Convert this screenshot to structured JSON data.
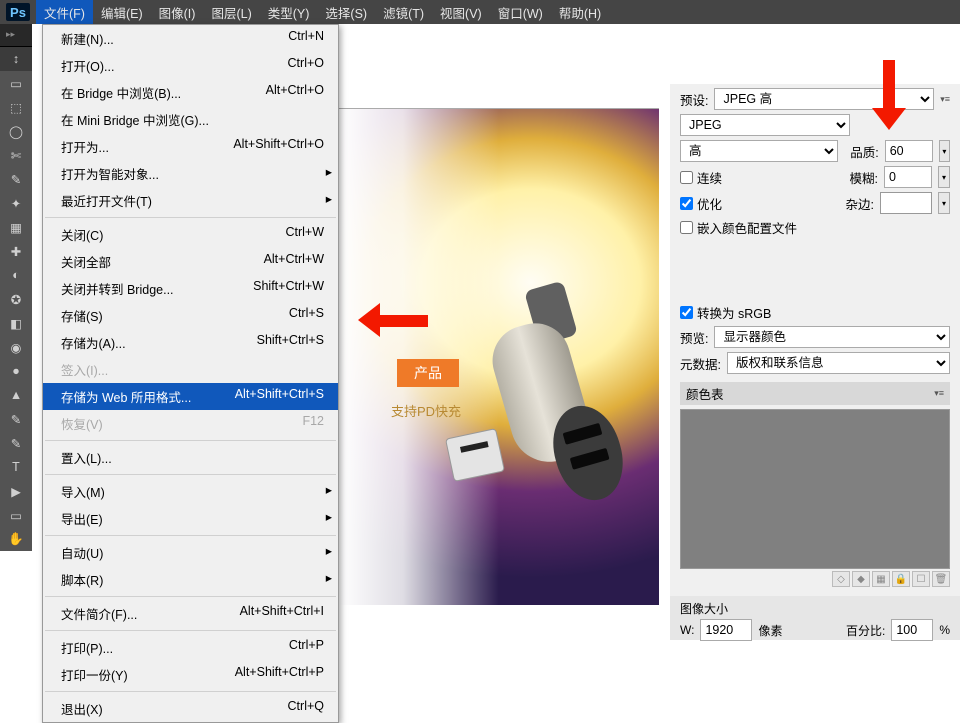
{
  "menubar": {
    "items": [
      "文件(F)",
      "编辑(E)",
      "图像(I)",
      "图层(L)",
      "类型(Y)",
      "选择(S)",
      "滤镜(T)",
      "视图(V)",
      "窗口(W)",
      "帮助(H)"
    ]
  },
  "file_menu": [
    {
      "t": "item",
      "label": "新建(N)...",
      "short": "Ctrl+N"
    },
    {
      "t": "item",
      "label": "打开(O)...",
      "short": "Ctrl+O"
    },
    {
      "t": "item",
      "label": "在 Bridge 中浏览(B)...",
      "short": "Alt+Ctrl+O"
    },
    {
      "t": "item",
      "label": "在 Mini Bridge 中浏览(G)..."
    },
    {
      "t": "item",
      "label": "打开为...",
      "short": "Alt+Shift+Ctrl+O"
    },
    {
      "t": "sub",
      "label": "打开为智能对象..."
    },
    {
      "t": "sub",
      "label": "最近打开文件(T)"
    },
    {
      "t": "sep"
    },
    {
      "t": "item",
      "label": "关闭(C)",
      "short": "Ctrl+W"
    },
    {
      "t": "item",
      "label": "关闭全部",
      "short": "Alt+Ctrl+W"
    },
    {
      "t": "item",
      "label": "关闭并转到 Bridge...",
      "short": "Shift+Ctrl+W"
    },
    {
      "t": "item",
      "label": "存储(S)",
      "short": "Ctrl+S"
    },
    {
      "t": "item",
      "label": "存储为(A)...",
      "short": "Shift+Ctrl+S"
    },
    {
      "t": "item",
      "label": "签入(I)...",
      "disabled": true
    },
    {
      "t": "item",
      "label": "存储为 Web 所用格式...",
      "short": "Alt+Shift+Ctrl+S",
      "selected": true
    },
    {
      "t": "item",
      "label": "恢复(V)",
      "short": "F12",
      "disabled": true
    },
    {
      "t": "sep"
    },
    {
      "t": "item",
      "label": "置入(L)..."
    },
    {
      "t": "sep"
    },
    {
      "t": "sub",
      "label": "导入(M)"
    },
    {
      "t": "sub",
      "label": "导出(E)"
    },
    {
      "t": "sep"
    },
    {
      "t": "sub",
      "label": "自动(U)"
    },
    {
      "t": "sub",
      "label": "脚本(R)"
    },
    {
      "t": "sep"
    },
    {
      "t": "item",
      "label": "文件简介(F)...",
      "short": "Alt+Shift+Ctrl+I"
    },
    {
      "t": "sep"
    },
    {
      "t": "item",
      "label": "打印(P)...",
      "short": "Ctrl+P"
    },
    {
      "t": "item",
      "label": "打印一份(Y)",
      "short": "Alt+Shift+Ctrl+P"
    },
    {
      "t": "sep"
    },
    {
      "t": "item",
      "label": "退出(X)",
      "short": "Ctrl+Q"
    }
  ],
  "panel": {
    "preset_label": "预设:",
    "preset_value": "JPEG 高",
    "format_value": "JPEG",
    "quality_level": "高",
    "quality_label": "品质:",
    "quality_value": "60",
    "blur_label": "模糊:",
    "blur_value": "0",
    "matte_label": "杂边:",
    "chk_progressive": "连续",
    "chk_optimized": "优化",
    "chk_embed": "嵌入颜色配置文件",
    "chk_srgb": "转换为 sRGB",
    "preview_label": "预览:",
    "preview_value": "显示器颜色",
    "meta_label": "元数据:",
    "meta_value": "版权和联系信息",
    "colortable": "颜色表",
    "imgsize_label": "图像大小",
    "w_label": "W:",
    "w_value": "1920",
    "unit": "像素",
    "percent_label": "百分比:",
    "percent_value": "100",
    "percent_unit": "%"
  },
  "tools": [
    "↕",
    "▭",
    "⬚",
    "◯",
    "✄",
    "✎",
    "✦",
    "▦",
    "✚",
    "◐",
    "✪",
    "◧",
    "◉",
    "●",
    "▲",
    "✎",
    "✎",
    "T",
    "▶",
    "▭",
    "✋"
  ],
  "canvas_text": {
    "badge": "产品",
    "subtitle": "支持PD快充"
  }
}
